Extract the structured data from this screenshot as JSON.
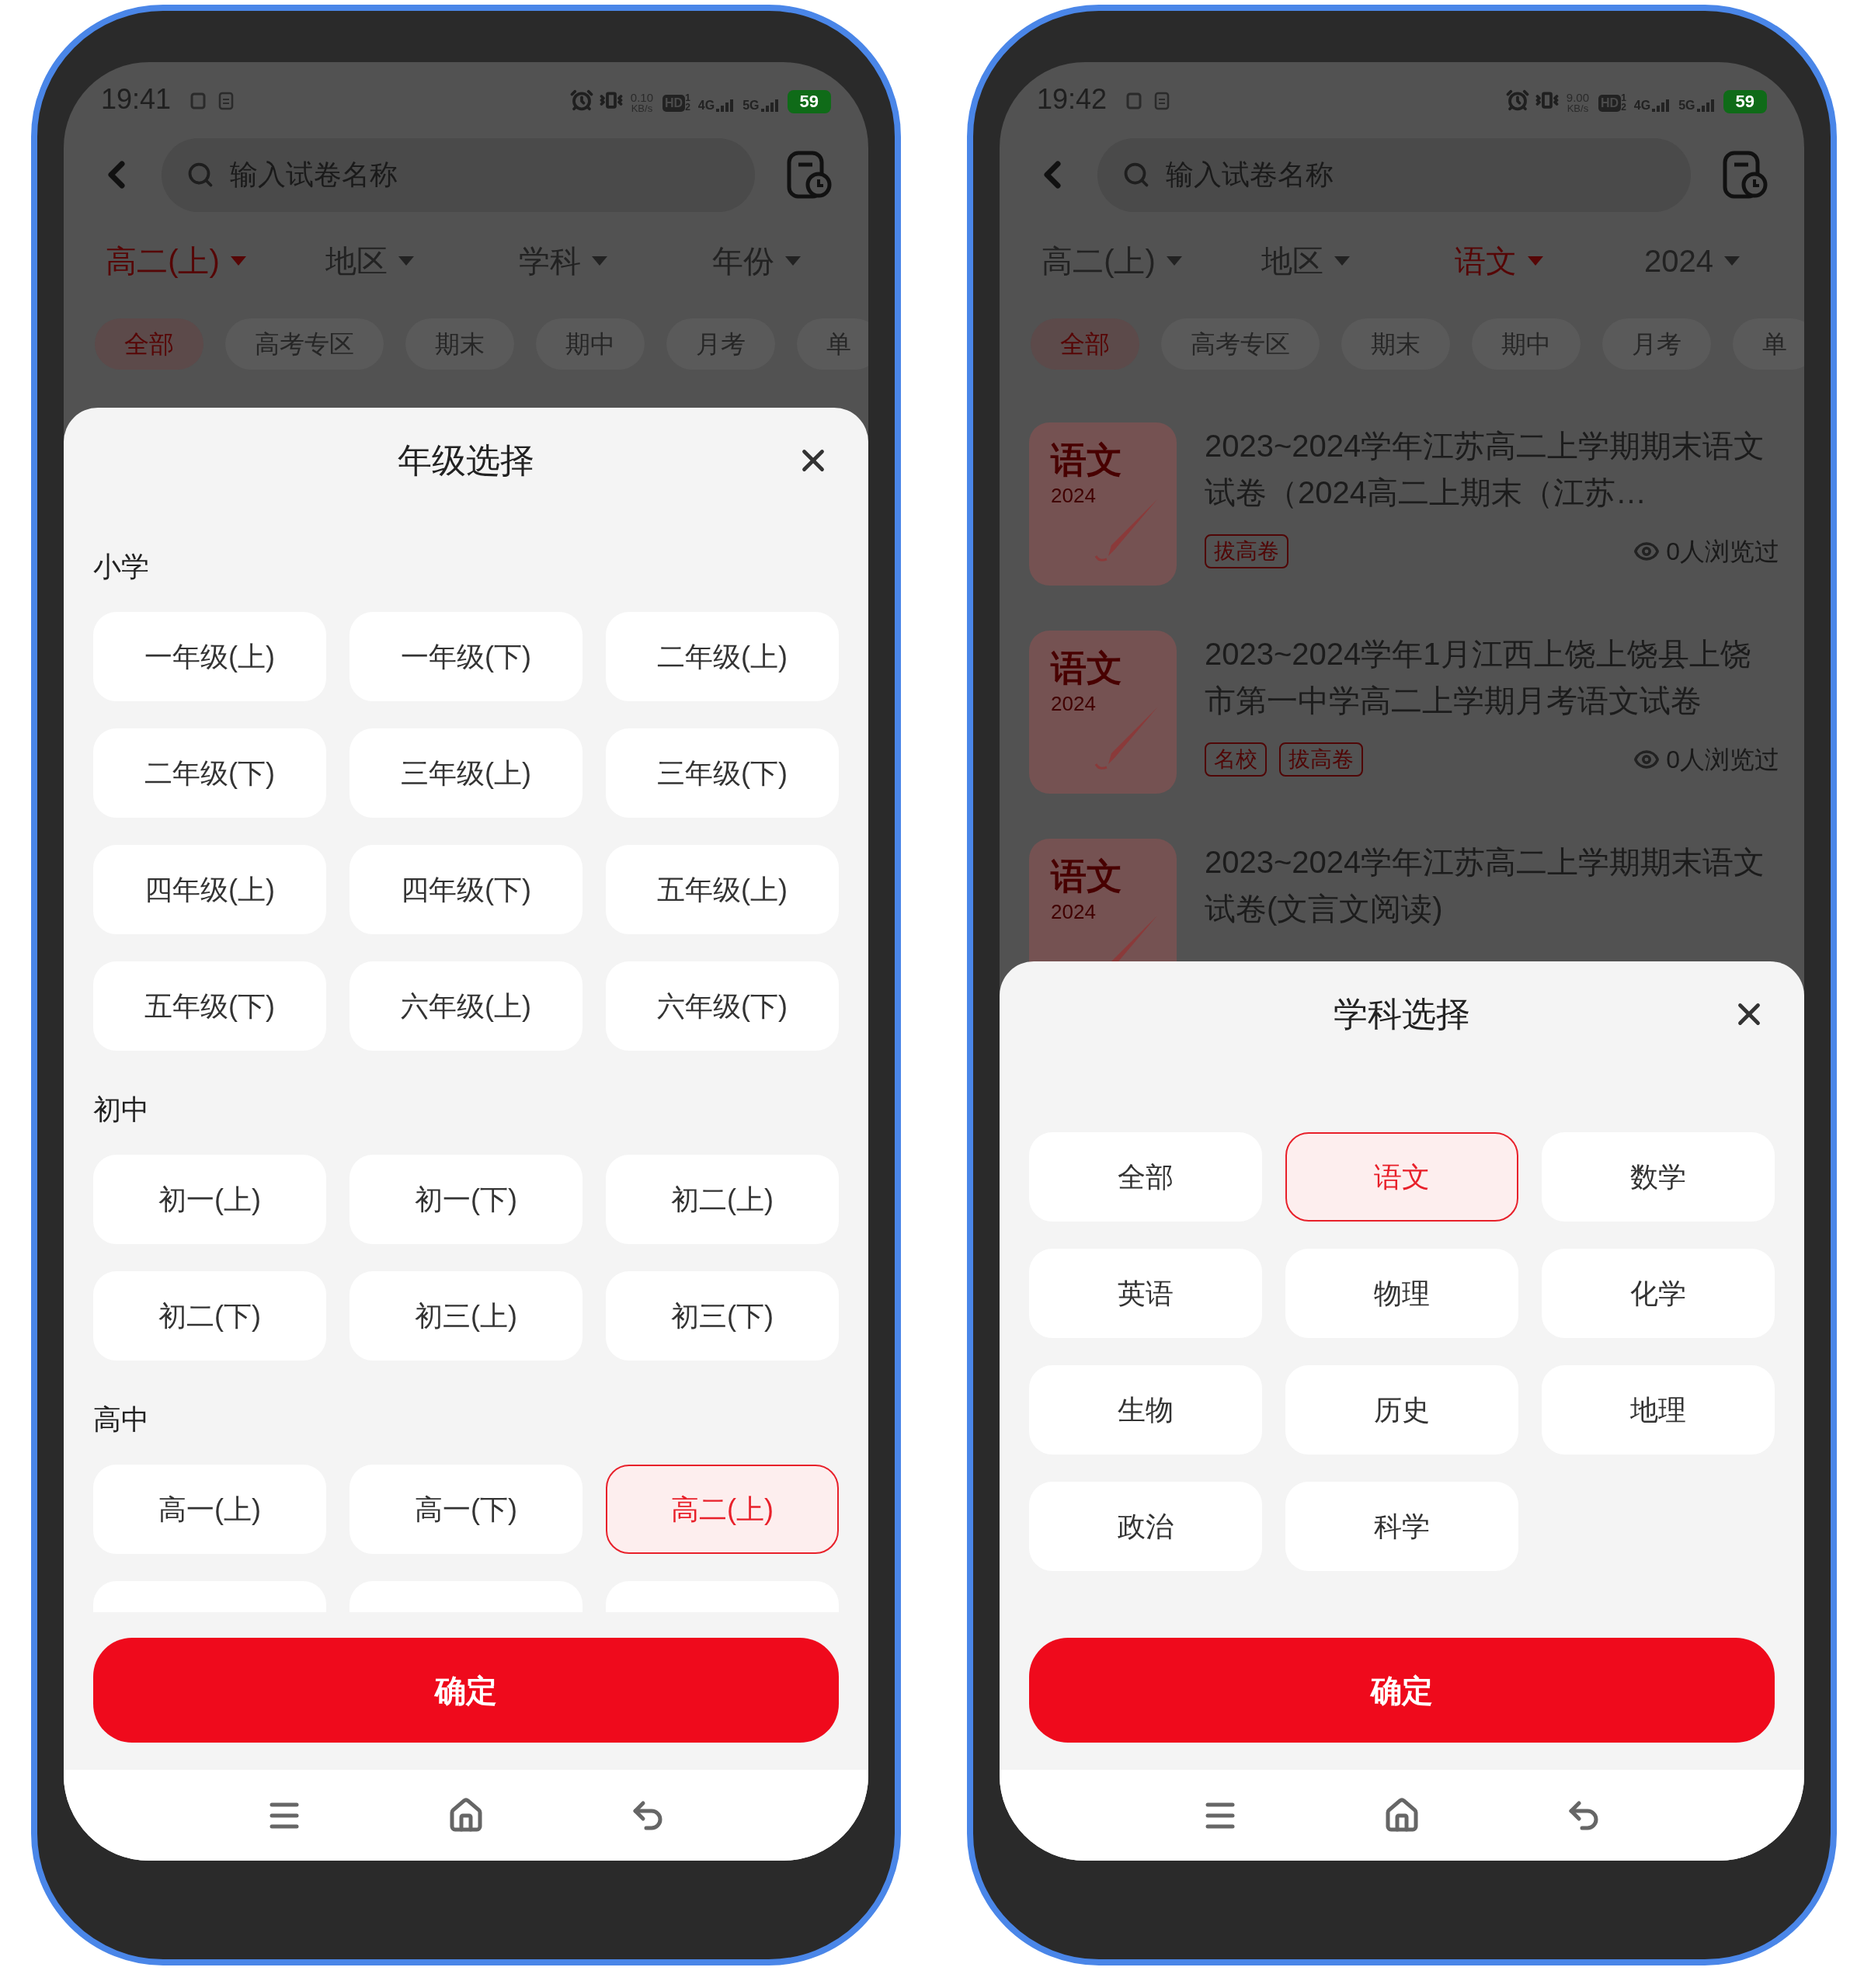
{
  "phones": [
    {
      "status_bar": {
        "time": "19:41",
        "speed": "0.10",
        "speed_unit": "KB/s",
        "hd": "HD",
        "hd_sims": [
          "1",
          "2"
        ],
        "networks": [
          "4G",
          "5G"
        ],
        "battery": "59"
      },
      "search": {
        "placeholder": "输入试卷名称"
      },
      "filters": [
        {
          "label": "高二(上)",
          "selected": true
        },
        {
          "label": "地区",
          "selected": false
        },
        {
          "label": "学科",
          "selected": false
        },
        {
          "label": "年份",
          "selected": false
        }
      ],
      "chips": [
        {
          "label": "全部",
          "selected": true
        },
        {
          "label": "高考专区",
          "selected": false
        },
        {
          "label": "期末",
          "selected": false
        },
        {
          "label": "期中",
          "selected": false
        },
        {
          "label": "月考",
          "selected": false
        },
        {
          "label": "单",
          "selected": false
        }
      ],
      "sheet": {
        "title": "年级选择",
        "sections": [
          {
            "heading": "小学",
            "options": [
              {
                "label": "一年级(上)",
                "selected": false
              },
              {
                "label": "一年级(下)",
                "selected": false
              },
              {
                "label": "二年级(上)",
                "selected": false
              },
              {
                "label": "二年级(下)",
                "selected": false
              },
              {
                "label": "三年级(上)",
                "selected": false
              },
              {
                "label": "三年级(下)",
                "selected": false
              },
              {
                "label": "四年级(上)",
                "selected": false
              },
              {
                "label": "四年级(下)",
                "selected": false
              },
              {
                "label": "五年级(上)",
                "selected": false
              },
              {
                "label": "五年级(下)",
                "selected": false
              },
              {
                "label": "六年级(上)",
                "selected": false
              },
              {
                "label": "六年级(下)",
                "selected": false
              }
            ]
          },
          {
            "heading": "初中",
            "options": [
              {
                "label": "初一(上)",
                "selected": false
              },
              {
                "label": "初一(下)",
                "selected": false
              },
              {
                "label": "初二(上)",
                "selected": false
              },
              {
                "label": "初二(下)",
                "selected": false
              },
              {
                "label": "初三(上)",
                "selected": false
              },
              {
                "label": "初三(下)",
                "selected": false
              }
            ]
          },
          {
            "heading": "高中",
            "options": [
              {
                "label": "高一(上)",
                "selected": false
              },
              {
                "label": "高一(下)",
                "selected": false
              },
              {
                "label": "高二(上)",
                "selected": true
              }
            ]
          }
        ],
        "confirm": "确定"
      }
    },
    {
      "status_bar": {
        "time": "19:42",
        "speed": "9.00",
        "speed_unit": "KB/s",
        "hd": "HD",
        "hd_sims": [
          "1",
          "2"
        ],
        "networks": [
          "4G",
          "5G"
        ],
        "battery": "59"
      },
      "search": {
        "placeholder": "输入试卷名称"
      },
      "filters": [
        {
          "label": "高二(上)",
          "selected": false
        },
        {
          "label": "地区",
          "selected": false
        },
        {
          "label": "语文",
          "selected": true
        },
        {
          "label": "2024",
          "selected": false
        }
      ],
      "chips": [
        {
          "label": "全部",
          "selected": true
        },
        {
          "label": "高考专区",
          "selected": false
        },
        {
          "label": "期末",
          "selected": false
        },
        {
          "label": "期中",
          "selected": false
        },
        {
          "label": "月考",
          "selected": false
        },
        {
          "label": "单",
          "selected": false
        }
      ],
      "papers": [
        {
          "thumb_subject": "语文",
          "thumb_year": "2024",
          "title": "2023~2024学年江苏高二上学期期末语文试卷（2024高二上期末（江苏…",
          "tags": [
            "拔高卷"
          ],
          "views": "0人浏览过"
        },
        {
          "thumb_subject": "语文",
          "thumb_year": "2024",
          "title": "2023~2024学年1月江西上饶上饶县上饶市第一中学高二上学期月考语文试卷",
          "tags": [
            "名校",
            "拔高卷"
          ],
          "views": "0人浏览过"
        },
        {
          "thumb_subject": "语文",
          "thumb_year": "2024",
          "title": "2023~2024学年江苏高二上学期期末语文试卷(文言文阅读)"
        }
      ],
      "sheet": {
        "title": "学科选择",
        "sections": [
          {
            "options": [
              {
                "label": "全部",
                "selected": false
              },
              {
                "label": "语文",
                "selected": true
              },
              {
                "label": "数学",
                "selected": false
              },
              {
                "label": "英语",
                "selected": false
              },
              {
                "label": "物理",
                "selected": false
              },
              {
                "label": "化学",
                "selected": false
              },
              {
                "label": "生物",
                "selected": false
              },
              {
                "label": "历史",
                "selected": false
              },
              {
                "label": "地理",
                "selected": false
              },
              {
                "label": "政治",
                "selected": false
              },
              {
                "label": "科学",
                "selected": false
              }
            ]
          }
        ],
        "confirm": "确定"
      }
    }
  ]
}
